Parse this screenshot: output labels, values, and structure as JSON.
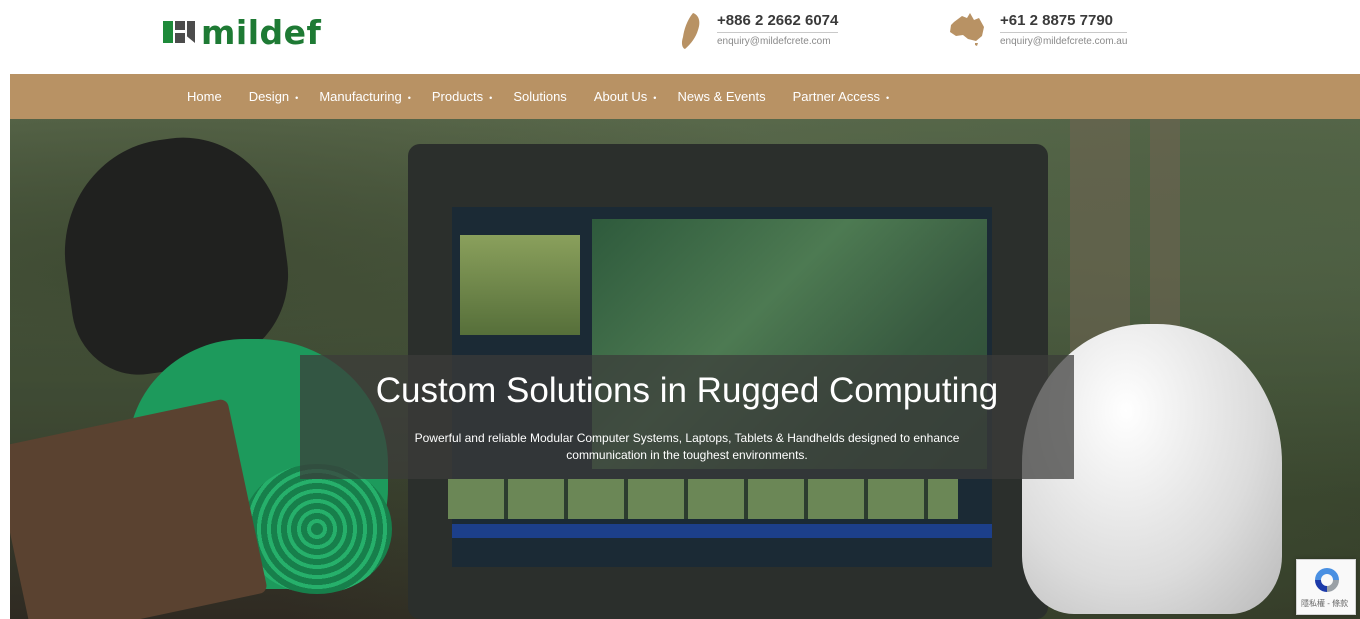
{
  "logo": {
    "text": "mildef",
    "brand_color": "#1e7a34"
  },
  "contacts": [
    {
      "country_icon": "taiwan-map-icon",
      "phone": "+886 2 2662 6074",
      "email": "enquiry@mildefcrete.com"
    },
    {
      "country_icon": "australia-map-icon",
      "phone": "+61 2 8875 7790",
      "email": "enquiry@mildefcrete.com.au"
    }
  ],
  "nav": {
    "background": "#b89264",
    "items": [
      {
        "label": "Home",
        "caret": ""
      },
      {
        "label": "Design",
        "caret": "•"
      },
      {
        "label": "Manufacturing",
        "caret": "•"
      },
      {
        "label": "Products",
        "caret": "•"
      },
      {
        "label": "Solutions",
        "caret": ""
      },
      {
        "label": "About Us",
        "caret": "•"
      },
      {
        "label": "News & Events",
        "caret": ""
      },
      {
        "label": "Partner Access",
        "caret": "•"
      }
    ]
  },
  "hero": {
    "title": "Custom Solutions in Rugged Computing",
    "subtitle": "Powerful and reliable Modular Computer Systems, Laptops, Tablets & Handhelds designed to enhance communication in the toughest environments."
  },
  "recaptcha": {
    "label": "隱私權 - 條款"
  }
}
